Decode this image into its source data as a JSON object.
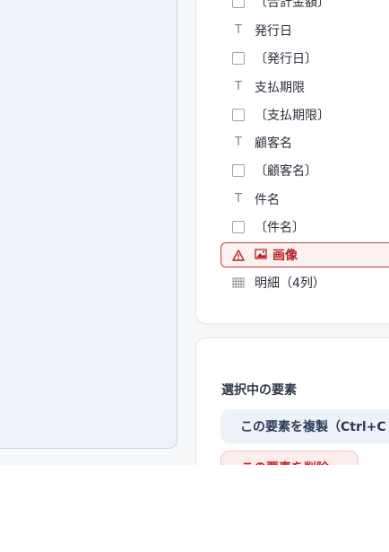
{
  "layers": [
    {
      "kind": "check",
      "label": "〔合計金額〕"
    },
    {
      "kind": "text",
      "label": "発行日"
    },
    {
      "kind": "check",
      "label": "〔発行日〕"
    },
    {
      "kind": "text",
      "label": "支払期限"
    },
    {
      "kind": "check",
      "label": "〔支払期限〕"
    },
    {
      "kind": "text",
      "label": "顧客名"
    },
    {
      "kind": "check",
      "label": "〔顧客名〕"
    },
    {
      "kind": "text",
      "label": "件名"
    },
    {
      "kind": "check",
      "label": "〔件名〕"
    }
  ],
  "active_layer": {
    "label": "画像",
    "warning_icon": "warning-icon",
    "image_icon": "image-icon"
  },
  "table_layer": {
    "label": "明細（4列）",
    "icon": "table-icon"
  },
  "selection": {
    "title": "選択中の要素",
    "duplicate_label": "この要素を複製（Ctrl+C",
    "delete_label": "この要素を削除"
  },
  "colors": {
    "danger": "#c93a3a",
    "danger_bg": "#fcf1f1",
    "secondary_bg": "#edf1f8",
    "canvas_bg": "#eff3f9"
  }
}
